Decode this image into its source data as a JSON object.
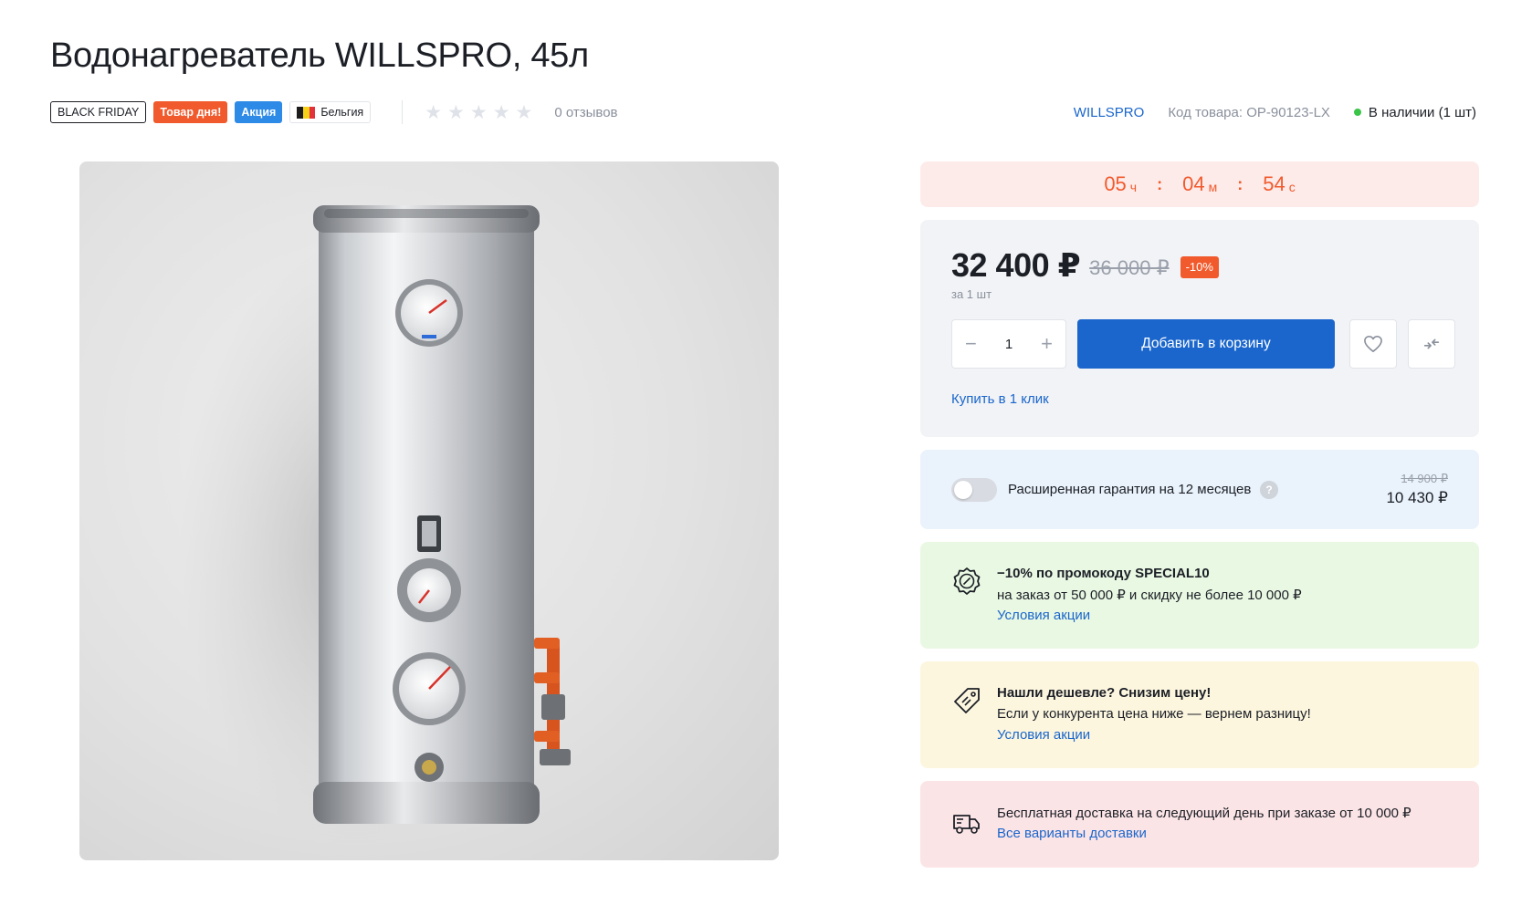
{
  "product": {
    "title": "Водонагреватель WILLSPRO, 45л",
    "badges": {
      "black_friday": "BLACK FRIDAY",
      "deal_of_day": "Товар дня!",
      "promo": "Акция",
      "country": "Бельгия"
    },
    "rating": {
      "stars": 0,
      "max_stars": 5,
      "reviews": "0 отзывов"
    },
    "brand": "WILLSPRO",
    "sku": "Код товара: OP-90123-LX",
    "stock": "В наличии (1 шт)"
  },
  "timer": {
    "hours": "05",
    "hours_unit": "ч",
    "minutes": "04",
    "minutes_unit": "м",
    "seconds": "54",
    "seconds_unit": "с",
    "separator": ":"
  },
  "price_card": {
    "price": "32 400 ₽",
    "old_price": "36 000 ₽",
    "discount": "-10%",
    "per_unit": "за 1 шт",
    "quantity": "1",
    "minus": "−",
    "plus": "+",
    "add_to_cart": "Добавить в корзину",
    "buy_one_click": "Купить в 1 клик"
  },
  "warranty": {
    "label": "Расширенная гарантия на 12 месяцев",
    "help": "?",
    "old_price": "14 900 ₽",
    "price": "10 430 ₽",
    "enabled": false
  },
  "promos": [
    {
      "icon": "discount-badge-icon",
      "title": "−10% по промокоду SPECIAL10",
      "text": "на заказ от 50 000 ₽ и скидку не более 10 000 ₽",
      "link": "Условия акции"
    },
    {
      "icon": "price-tag-icon",
      "title": "Нашли дешевле? Снизим цену!",
      "text": "Если у конкурента цена ниже — вернем разницу!",
      "link": "Условия акции"
    },
    {
      "icon": "delivery-truck-icon",
      "text": "Бесплатная доставка на следующий день при заказе от 10 000 ₽",
      "link": "Все варианты доставки"
    }
  ],
  "colors": {
    "accent_blue": "#1a66cc",
    "accent_orange": "#f15a2c",
    "sale_blue": "#2d8ae6",
    "in_stock_green": "#3ac448"
  }
}
